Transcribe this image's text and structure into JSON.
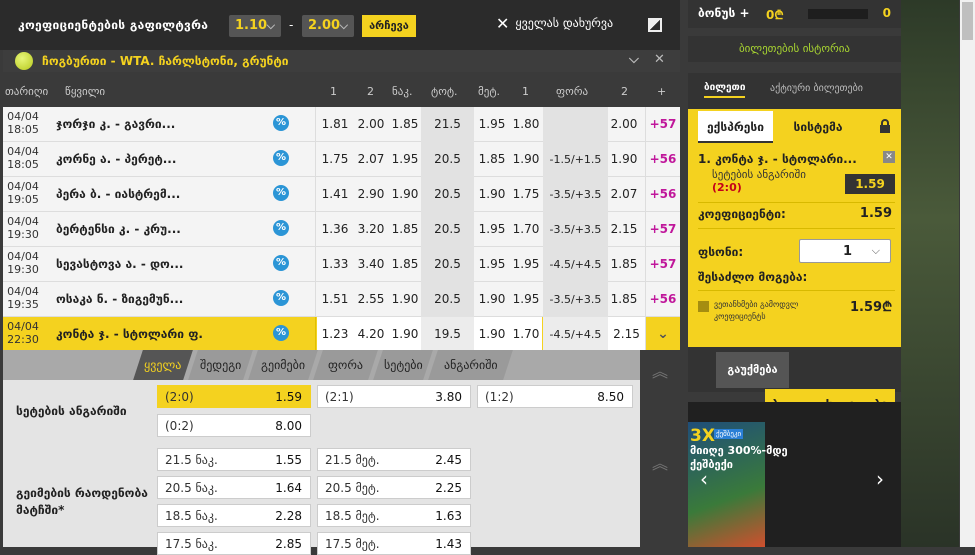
{
  "filter": {
    "title": "კოეფიციენტების გაფილტვრა",
    "min": "1.10",
    "dash": "-",
    "max": "2.00",
    "choose_label": "არჩევა",
    "close_all_label": "ყველას დახურვა"
  },
  "tournament": {
    "name": "ჩოგბურთი - WTA. ჩარლსტონი, გრუნტი"
  },
  "columns": {
    "date": "თარიღი",
    "pair": "წყვილი",
    "c1": "1",
    "c2": "2",
    "under": "ნაკ.",
    "total": "ტოტ.",
    "over": "მეტ.",
    "h1": "1",
    "handicap": "ფორა",
    "h2": "2",
    "plus": "+"
  },
  "matches": [
    {
      "date": "04/04",
      "time": "18:05",
      "name": "ჯორჯი კ. - გავრი...",
      "c1": "1.81",
      "c2": "2.00",
      "under": "1.85",
      "total": "21.5",
      "over": "1.95",
      "h1": "1.80",
      "hcp": "",
      "h2": "2.00",
      "more": "+57"
    },
    {
      "date": "04/04",
      "time": "18:05",
      "name": "კორნე ა. - პერეტ...",
      "c1": "1.75",
      "c2": "2.07",
      "under": "1.95",
      "total": "20.5",
      "over": "1.85",
      "h1": "1.90",
      "hcp": "-1.5/+1.5",
      "h2": "1.90",
      "more": "+56"
    },
    {
      "date": "04/04",
      "time": "19:05",
      "name": "პერა ბ. - იასტრემ...",
      "c1": "1.41",
      "c2": "2.90",
      "under": "1.90",
      "total": "20.5",
      "over": "1.90",
      "h1": "1.75",
      "hcp": "-3.5/+3.5",
      "h2": "2.07",
      "more": "+56"
    },
    {
      "date": "04/04",
      "time": "19:30",
      "name": "ბერტენსი კ. - კრუ...",
      "c1": "1.36",
      "c2": "3.20",
      "under": "1.85",
      "total": "20.5",
      "over": "1.95",
      "h1": "1.70",
      "hcp": "-3.5/+3.5",
      "h2": "2.15",
      "more": "+57"
    },
    {
      "date": "04/04",
      "time": "19:30",
      "name": "სევასტოვა ა. - დო...",
      "c1": "1.33",
      "c2": "3.40",
      "under": "1.85",
      "total": "20.5",
      "over": "1.95",
      "h1": "1.95",
      "hcp": "-4.5/+4.5",
      "h2": "1.85",
      "more": "+57"
    },
    {
      "date": "04/04",
      "time": "19:35",
      "name": "ოსაკა ნ. - ზიგემუნ...",
      "c1": "1.51",
      "c2": "2.55",
      "under": "1.90",
      "total": "20.5",
      "over": "1.90",
      "h1": "1.95",
      "hcp": "-3.5/+3.5",
      "h2": "1.85",
      "more": "+56"
    },
    {
      "date": "04/04",
      "time": "22:30",
      "name": "კონტა ჯ. - სტოლარი ფ.",
      "c1": "1.23",
      "c2": "4.20",
      "under": "1.90",
      "total": "19.5",
      "over": "1.90",
      "h1": "1.70",
      "hcp": "-4.5/+4.5",
      "h2": "2.15",
      "more": "⌄"
    }
  ],
  "market_tabs": [
    "ყველა",
    "შედეგი",
    "გეიმები",
    "ფორა",
    "სეტები",
    "ანგარიში"
  ],
  "set_score": {
    "label": "სეტების ანგარიში",
    "odds": [
      [
        "(2:0)",
        "1.59"
      ],
      [
        "(2:1)",
        "3.80"
      ],
      [
        "(1:2)",
        "8.50"
      ],
      [
        "(0:2)",
        "8.00"
      ]
    ]
  },
  "games_total": {
    "label": "გეიმების რაოდენობა მატჩში*",
    "odds": [
      [
        "21.5 ნაკ.",
        "1.55"
      ],
      [
        "21.5 მეტ.",
        "2.45"
      ],
      [
        "20.5 ნაკ.",
        "1.64"
      ],
      [
        "20.5 მეტ.",
        "2.25"
      ],
      [
        "18.5 ნაკ.",
        "2.28"
      ],
      [
        "18.5 მეტ.",
        "1.63"
      ],
      [
        "17.5 ნაკ.",
        "2.85"
      ],
      [
        "17.5 მეტ.",
        "1.43"
      ]
    ]
  },
  "bonus": {
    "label": "ბონუს +",
    "value": "0₾",
    "counter": "0"
  },
  "history_label": "ბილეთების ისტორია",
  "betslip_tabs": {
    "ticket": "ბილეთი",
    "multi": "აქტიური ბილეთები"
  },
  "slip": {
    "tab_express": "ექსპრესი",
    "tab_system": "სისტემა",
    "pick_team": "1. კონტა ჯ. - სტოლარი...",
    "pick_market": "სეტების ანგარიში",
    "pick_score": "(2:0)",
    "pick_odd": "1.59",
    "coef_label": "კოეფიციენტი:",
    "coef_value": "1.59",
    "stake_label": "ფსონი:",
    "stake_value": "1",
    "win_label": "შესაძლო მოგება:",
    "win_value": "1.59₾",
    "accept_text": "ვეთანხმები გამოდვლ კოეფიციენტს",
    "clear_label": "გაუქმება",
    "place_label": "ბილეთის დადება"
  },
  "banner": {
    "big": "3X",
    "badge": "ქეშბეკი",
    "line1": "მიიღე 300%-მდე",
    "line2": "ქეშბექი"
  },
  "colors": {
    "accent": "#f4d21f",
    "more": "#c0179b",
    "stat": "#2b95d6",
    "dark": "#2b2b2b"
  }
}
